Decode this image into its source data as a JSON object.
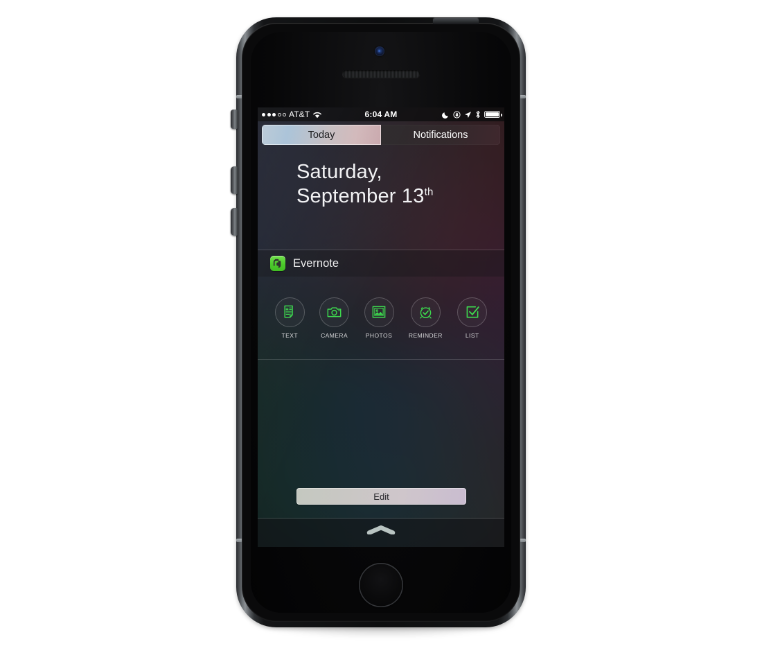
{
  "device": {
    "name": "iPhone 5s Space Gray",
    "hardware": {
      "power_button": "power-button",
      "mute_switch": "mute-switch",
      "volume_up": "volume-up-button",
      "volume_down": "volume-down-button",
      "home_button": "home-button",
      "front_camera": "front-camera",
      "earpiece_speaker": "earpiece-speaker"
    }
  },
  "status_bar": {
    "signal_dots": [
      true,
      true,
      true,
      false,
      false
    ],
    "carrier": "AT&T",
    "wifi_icon": "wifi-icon",
    "time": "6:04 AM",
    "icons": [
      "do-not-disturb-icon",
      "rotation-lock-icon",
      "location-arrow-icon",
      "bluetooth-icon",
      "battery-icon"
    ],
    "battery_level": 100
  },
  "segmented_control": {
    "selected": "Today",
    "tabs": [
      {
        "label": "Today",
        "selected": true
      },
      {
        "label": "Notifications",
        "selected": false
      }
    ]
  },
  "date_header": {
    "line1": "Saturday,",
    "line2_main": "September 13",
    "line2_suffix": "th"
  },
  "widget": {
    "app_name": "Evernote",
    "app_icon": "evernote-icon",
    "accent_color": "#4ed139",
    "actions": [
      {
        "label": "TEXT",
        "icon": "text-note-icon"
      },
      {
        "label": "CAMERA",
        "icon": "camera-icon"
      },
      {
        "label": "PHOTOS",
        "icon": "photos-icon"
      },
      {
        "label": "REMINDER",
        "icon": "reminder-alarm-icon"
      },
      {
        "label": "LIST",
        "icon": "checklist-icon"
      }
    ]
  },
  "edit": {
    "label": "Edit"
  },
  "grabber": {
    "icon": "grabber-chevron-up-icon"
  }
}
